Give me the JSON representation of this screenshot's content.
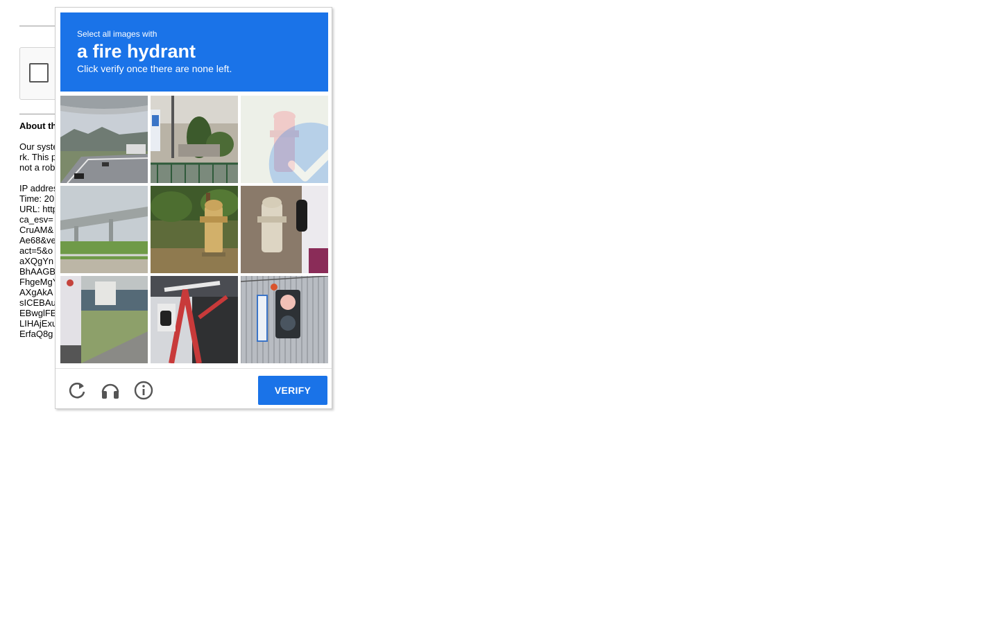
{
  "background_page": {
    "about_heading": "About th",
    "lines": [
      "Our syste",
      "rk. This p",
      "not a rob",
      "",
      "IP addres",
      "Time: 20",
      "URL: http",
      "ca_esv=",
      "CruAM&",
      "Ae68&ve",
      "act=5&o",
      "aXQgYn",
      "BhAAGB",
      "FhgeMgY",
      "AXgAkA",
      "sICEBAu",
      "EBwglFE",
      "LIHAjExu",
      "ErfaQ8g"
    ]
  },
  "captcha": {
    "instruction_small": "Select all images with",
    "instruction_target": "a fire hydrant",
    "instruction_note": "Click verify once there are none left.",
    "tiles": [
      {
        "subject": "highway overpass and mountains",
        "selected": false
      },
      {
        "subject": "truck and street shrubs",
        "selected": false
      },
      {
        "subject": "fire hydrant",
        "selected": true
      },
      {
        "subject": "highway bridge",
        "selected": false
      },
      {
        "subject": "yellow fire hydrant in grass",
        "selected": false
      },
      {
        "subject": "white fire hydrant next to truck",
        "selected": false
      },
      {
        "subject": "truck by river",
        "selected": false
      },
      {
        "subject": "bicycle",
        "selected": false
      },
      {
        "subject": "pedestrian traffic signal",
        "selected": false
      }
    ],
    "icons": [
      "reload-icon",
      "headphones-icon",
      "info-icon"
    ],
    "verify_label": "VERIFY",
    "colors": {
      "accent": "#1a73e8",
      "icon_gray": "#555555"
    }
  }
}
